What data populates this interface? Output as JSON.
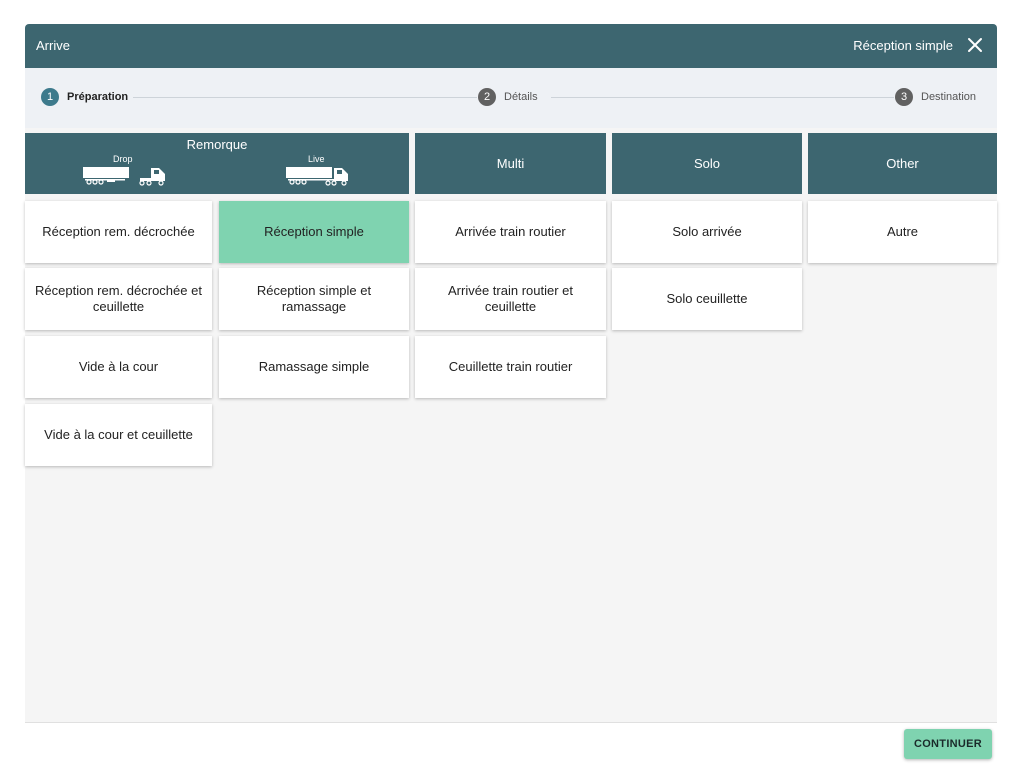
{
  "titlebar": {
    "title": "Arrive",
    "right_label": "Réception simple"
  },
  "steps": [
    {
      "num": "1",
      "label": "Préparation"
    },
    {
      "num": "2",
      "label": "Détails"
    },
    {
      "num": "3",
      "label": "Destination"
    }
  ],
  "columns": {
    "remorque": {
      "title": "Remorque",
      "drop": "Drop",
      "live": "Live"
    },
    "multi": "Multi",
    "solo": "Solo",
    "other": "Other"
  },
  "cards": {
    "drop": [
      "Réception rem. décrochée",
      "Réception rem. décrochée et ceuillette",
      "Vide à la cour",
      "Vide à la cour et ceuillette"
    ],
    "live": [
      "Réception simple",
      "Réception simple et ramassage",
      "Ramassage simple"
    ],
    "multi": [
      "Arrivée train routier",
      "Arrivée train routier et ceuillette",
      "Ceuillette train routier"
    ],
    "solo": [
      "Solo arrivée",
      "Solo ceuillette"
    ],
    "other": [
      "Autre"
    ]
  },
  "selected_card": "Réception simple",
  "footer": {
    "continue_label": "CONTINUER"
  },
  "colors": {
    "header": "#3d6670",
    "selected": "#7fd3b0",
    "stepper_bg": "#eef1f5"
  }
}
